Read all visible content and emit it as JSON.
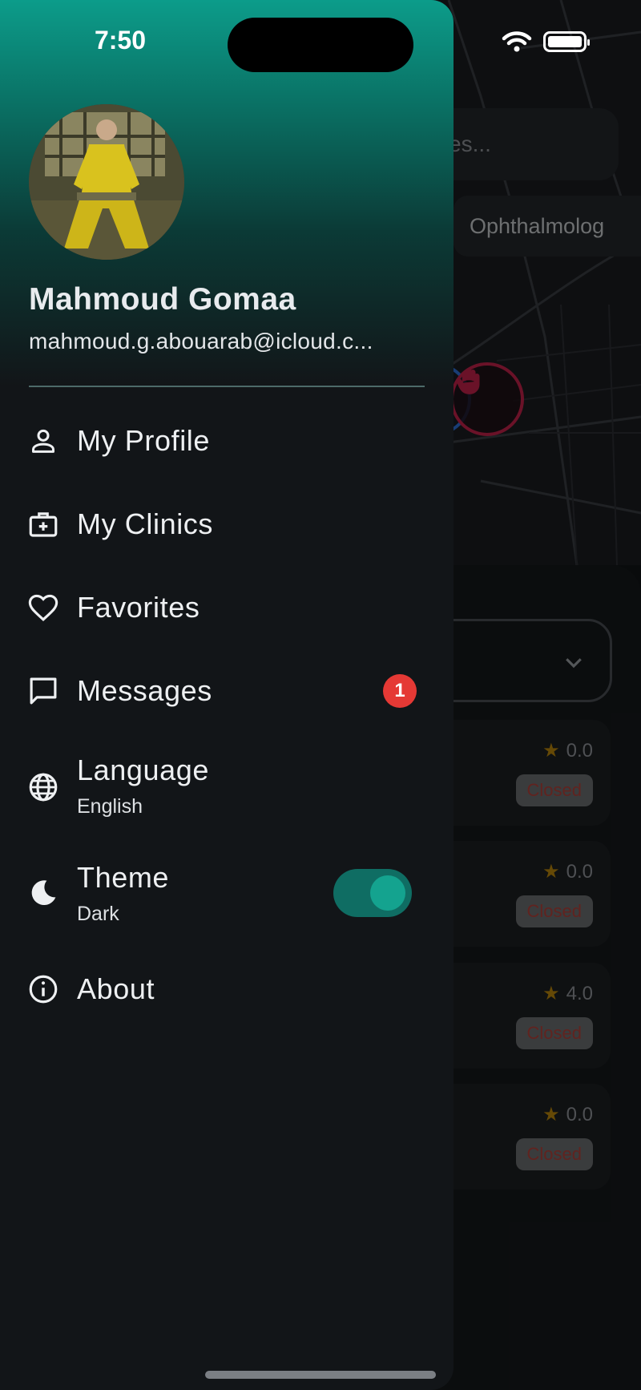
{
  "status_bar": {
    "time": "7:50"
  },
  "background": {
    "search_placeholder_fragment": "es...",
    "filter_chip": "Ophthalmolog",
    "clinic_cards": [
      {
        "rating": "0.0",
        "status": "Closed"
      },
      {
        "rating": "0.0",
        "status": "Closed"
      },
      {
        "rating": "4.0",
        "status": "Closed"
      },
      {
        "rating": "0.0",
        "status": "Closed"
      }
    ]
  },
  "drawer": {
    "user": {
      "name": "Mahmoud Gomaa",
      "email": "mahmoud.g.abouarab@icloud.c..."
    },
    "menu": {
      "profile": "My Profile",
      "clinics": "My Clinics",
      "favorites": "Favorites",
      "messages": "Messages",
      "messages_badge": "1",
      "language": "Language",
      "language_value": "English",
      "theme": "Theme",
      "theme_value": "Dark",
      "about": "About"
    },
    "theme_toggle_on": true
  },
  "colors": {
    "accent": "#14a38f",
    "badge": "#e53935",
    "header_gradient_top": "#0c9c8a"
  },
  "icons": [
    "person-icon",
    "medical-bag-icon",
    "heart-icon",
    "chat-icon",
    "globe-icon",
    "moon-icon",
    "info-icon",
    "wifi-icon",
    "battery-icon",
    "chevron-down-icon",
    "star-icon",
    "hand-icon"
  ]
}
